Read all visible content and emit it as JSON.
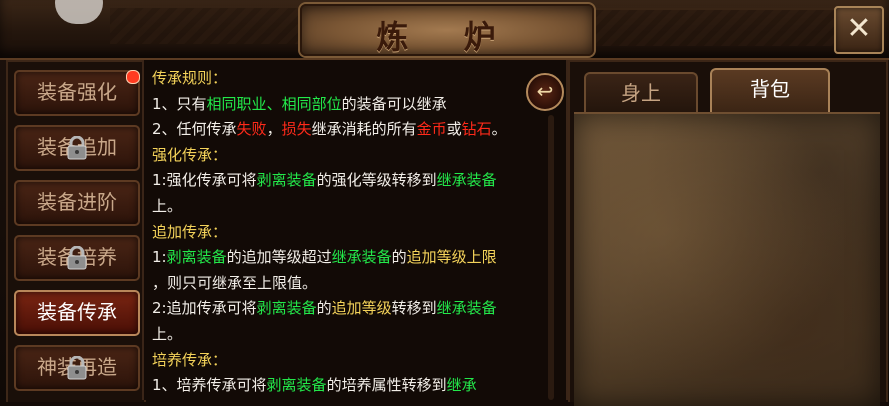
{
  "window": {
    "title": "炼 炉",
    "close_glyph": "✕"
  },
  "menu": {
    "items": [
      {
        "label": "装备强化",
        "locked": false,
        "active": false,
        "dot": true
      },
      {
        "label": "装备追加",
        "locked": true,
        "active": false,
        "dot": false
      },
      {
        "label": "装备进阶",
        "locked": false,
        "active": false,
        "dot": false
      },
      {
        "label": "装备培养",
        "locked": true,
        "active": false,
        "dot": false
      },
      {
        "label": "装备传承",
        "locked": false,
        "active": true,
        "dot": false
      },
      {
        "label": "神装再造",
        "locked": true,
        "active": false,
        "dot": false
      }
    ]
  },
  "rules": {
    "heading": "传承规则：",
    "r1_a": "1、只有",
    "r1_b": "相同职业",
    "r1_c": "、",
    "r1_d": "相同部位",
    "r1_e": "的装备可以继承",
    "r2_a": "2、任何传承",
    "r2_b": "失败",
    "r2_c": "，",
    "r2_d": "损失",
    "r2_e": "继承消耗的所有",
    "r2_f": "金币",
    "r2_g": "或",
    "r2_h": "钻石",
    "r2_i": "。",
    "s1_heading": "强化传承：",
    "s1_a": "1:强化传承可将",
    "s1_b": "剥离装备",
    "s1_c": "的强化等级转移到",
    "s1_d": "继承装备",
    "s1_e": "上。",
    "s2_heading": "追加传承：",
    "s2_a": "1:",
    "s2_b": "剥离装备",
    "s2_c": "的追加等级超过",
    "s2_d": "继承装备",
    "s2_e": "的",
    "s2_f": "追加等级上限",
    "s2_g": "，则只可继承至上限值。",
    "s2_h": "2:追加传承可将",
    "s2_i": "剥离装备",
    "s2_j": "的",
    "s2_k": "追加等级",
    "s2_l": "转移到",
    "s2_m": "继承装备",
    "s2_n": "上。",
    "s3_heading": "培养传承：",
    "s3_a": "1、培养传承可将",
    "s3_b": "剥离装备",
    "s3_c": "的培养属性转移到",
    "s3_d": "继承",
    "back_glyph": "↩"
  },
  "right": {
    "tabs": [
      {
        "label": "身上",
        "active": false
      },
      {
        "label": "背包",
        "active": true
      }
    ]
  },
  "colors": {
    "yellow": "#f4d35a",
    "green": "#23e84a",
    "red": "#ff2a1a"
  }
}
